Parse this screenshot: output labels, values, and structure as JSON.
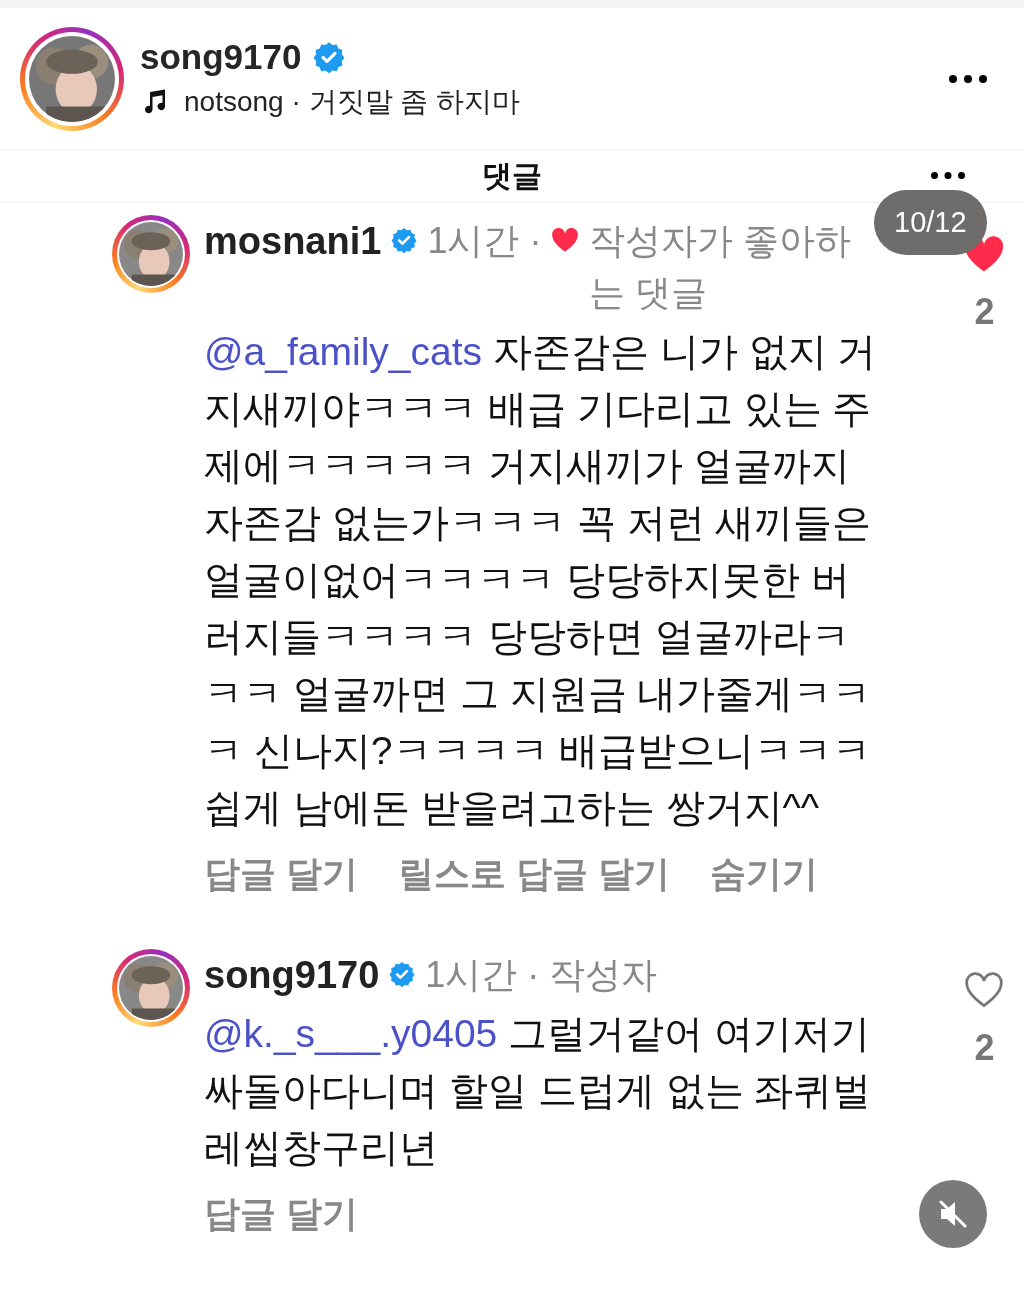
{
  "post": {
    "username": "song9170",
    "verified": true,
    "audio": "notsong · 거짓말 좀 하지마"
  },
  "sheet": {
    "title": "댓글"
  },
  "counter": "10/12",
  "comments": [
    {
      "username": "mosnani1",
      "verified": true,
      "time": "1시간",
      "separator": "·",
      "liked_by_author": true,
      "tag": "작성자가 좋아하는 댓글",
      "mention": "@a_family_cats",
      "text": "자존감은 니가 없지 거지새끼야ㅋㅋㅋ 배급 기다리고 있는 주제에ㅋㅋㅋㅋㅋ 거지새끼가 얼굴까지 자존감 없는가ㅋㅋㅋ 꼭 저런 새끼들은 얼굴이없어ㅋㅋㅋㅋ 당당하지못한 버러지들ㅋㅋㅋㅋ 당당하면 얼굴까라ㅋㅋㅋ 얼굴까면 그 지원금 내가줄게ㅋㅋㅋ 신나지?ㅋㅋㅋㅋ 배급받으니ㅋㅋㅋ 쉽게 남에돈 받을려고하는 쌍거지^^",
      "liked": true,
      "like_count": "2",
      "actions": [
        "답글 달기",
        "릴스로 답글 달기",
        "숨기기"
      ]
    },
    {
      "username": "song9170",
      "verified": true,
      "time": "1시간",
      "separator": "·",
      "liked_by_author": false,
      "tag": "작성자",
      "mention": "@k._s___.y0405",
      "text": "그럴거같어 여기저기 싸돌아다니며 할일 드럽게 없는 좌퀴벌레씹창구리년",
      "liked": false,
      "like_count": "2",
      "actions": [
        "답글 달기"
      ]
    }
  ],
  "muted": true
}
